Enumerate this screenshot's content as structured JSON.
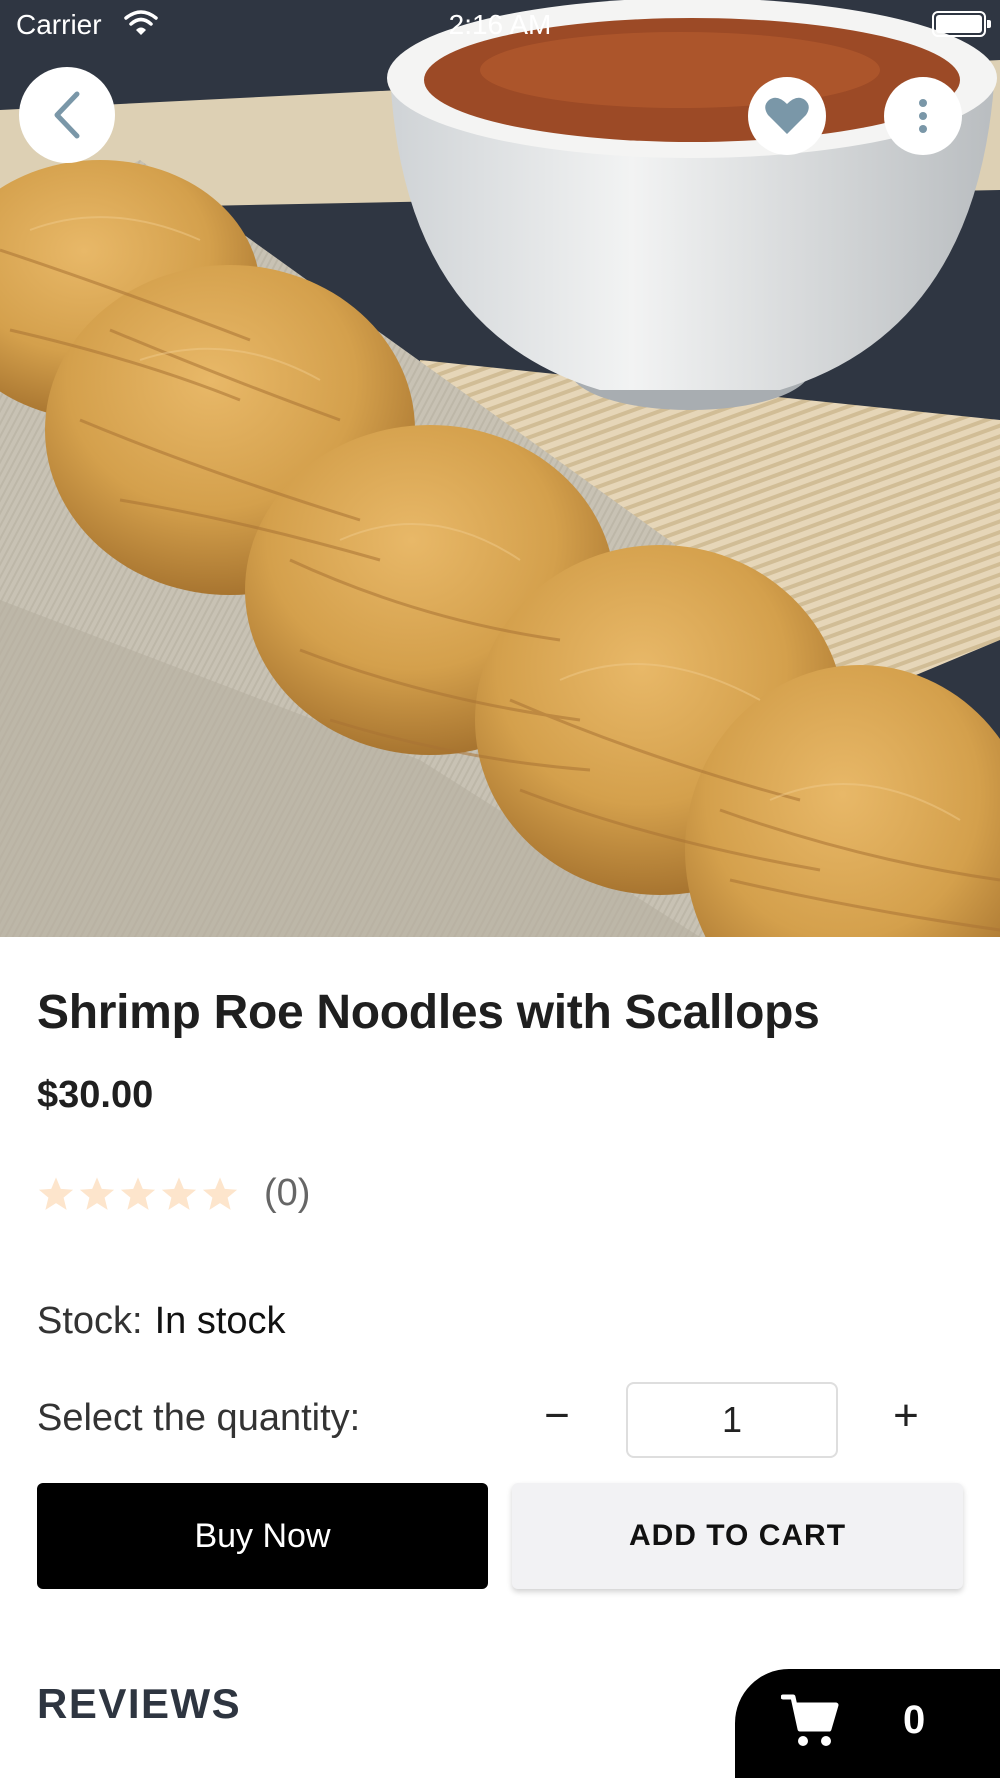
{
  "status_bar": {
    "carrier": "Carrier",
    "time": "2:16 AM"
  },
  "top_bar": {
    "back_icon": "chevron-left-icon",
    "favorite_icon": "heart-icon",
    "more_icon": "more-vertical-icon"
  },
  "product": {
    "name": "Shrimp Roe Noodles with Scallops",
    "price": "$30.00",
    "rating_stars": 0,
    "rating_max": 5,
    "rating_count": "(0)",
    "stock_label": "Stock:",
    "stock_value": "In stock"
  },
  "quantity": {
    "label": "Select the quantity:",
    "minus": "−",
    "value": "1",
    "plus": "+"
  },
  "actions": {
    "buy_now": "Buy Now",
    "add_to_cart": "ADD TO CART"
  },
  "reviews": {
    "heading": "REVIEWS"
  },
  "cart": {
    "icon": "cart-icon",
    "count": "0"
  },
  "colors": {
    "primary": "#000000",
    "secondary_button_bg": "#f2f2f4",
    "star_empty": "#fde5cc",
    "heart": "#7a97a8"
  }
}
